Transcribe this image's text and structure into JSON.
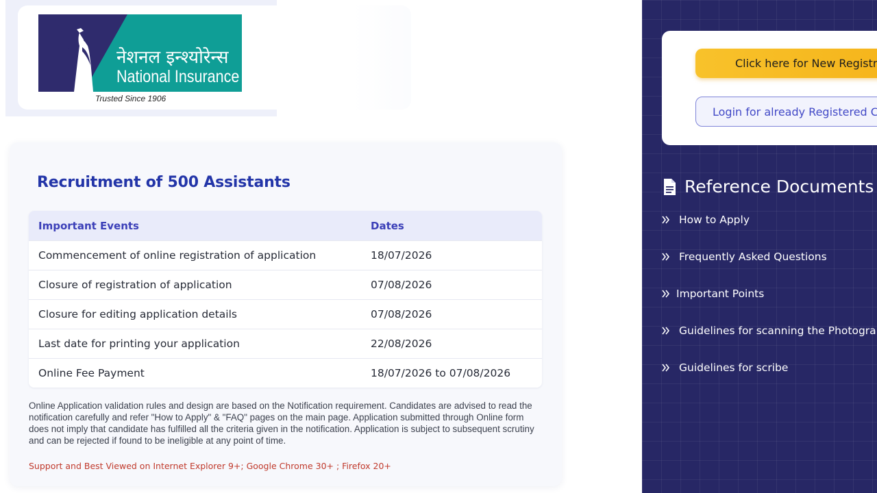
{
  "logo": {
    "hindi_text": "नेशनल इन्श्योरेन्स",
    "english_text": "National Insurance",
    "tagline": "Trusted Since 1906",
    "colors": {
      "teal": "#0f9e96",
      "navy": "#2f2b6d"
    }
  },
  "main": {
    "title": "Recruitment of 500 Assistants",
    "table": {
      "headers": [
        "Important Events",
        "Dates"
      ],
      "rows": [
        {
          "event": "Commencement of online registration of application",
          "date": "18/07/2026"
        },
        {
          "event": "Closure of registration of application",
          "date": "07/08/2026"
        },
        {
          "event": "Closure for editing application details",
          "date": "07/08/2026"
        },
        {
          "event": "Last date for printing your application",
          "date": "22/08/2026"
        },
        {
          "event": "Online Fee Payment",
          "date": "18/07/2026 to 07/08/2026"
        }
      ]
    },
    "note": "Online Application validation rules and design are based on the Notification requirement. Candidates are advised to read the notification carefully and refer \"How to Apply\" & \"FAQ\" pages on the main page. Application submitted through Online form does not imply that candidate has fulfilled all the criteria given in the notification. Application is subject to subsequent scrutiny and can be rejected if found to be ineligible at any point of time.",
    "support": "Support and Best Viewed on Internet Explorer 9+; Google Chrome 30+ ; Firefox 20+"
  },
  "sidebar": {
    "register_button": "Click here for New Registrat",
    "login_button": "Login for already Registered Can",
    "reference_heading": "Reference Documents",
    "links": [
      {
        "label": "How to Apply",
        "icon": "double-chevron-right-icon"
      },
      {
        "label": "Frequently Asked Questions",
        "icon": "double-chevron-right-icon"
      },
      {
        "label": "Important Points",
        "icon": "double-chevron-right-icon"
      },
      {
        "label": "Guidelines for scanning the Photograph",
        "icon": "double-chevron-right-icon"
      },
      {
        "label": "Guidelines for scribe",
        "icon": "double-chevron-right-icon"
      }
    ],
    "colors": {
      "panel": "#272765",
      "accent": "#f8c22b",
      "link": "#4148c6"
    }
  }
}
